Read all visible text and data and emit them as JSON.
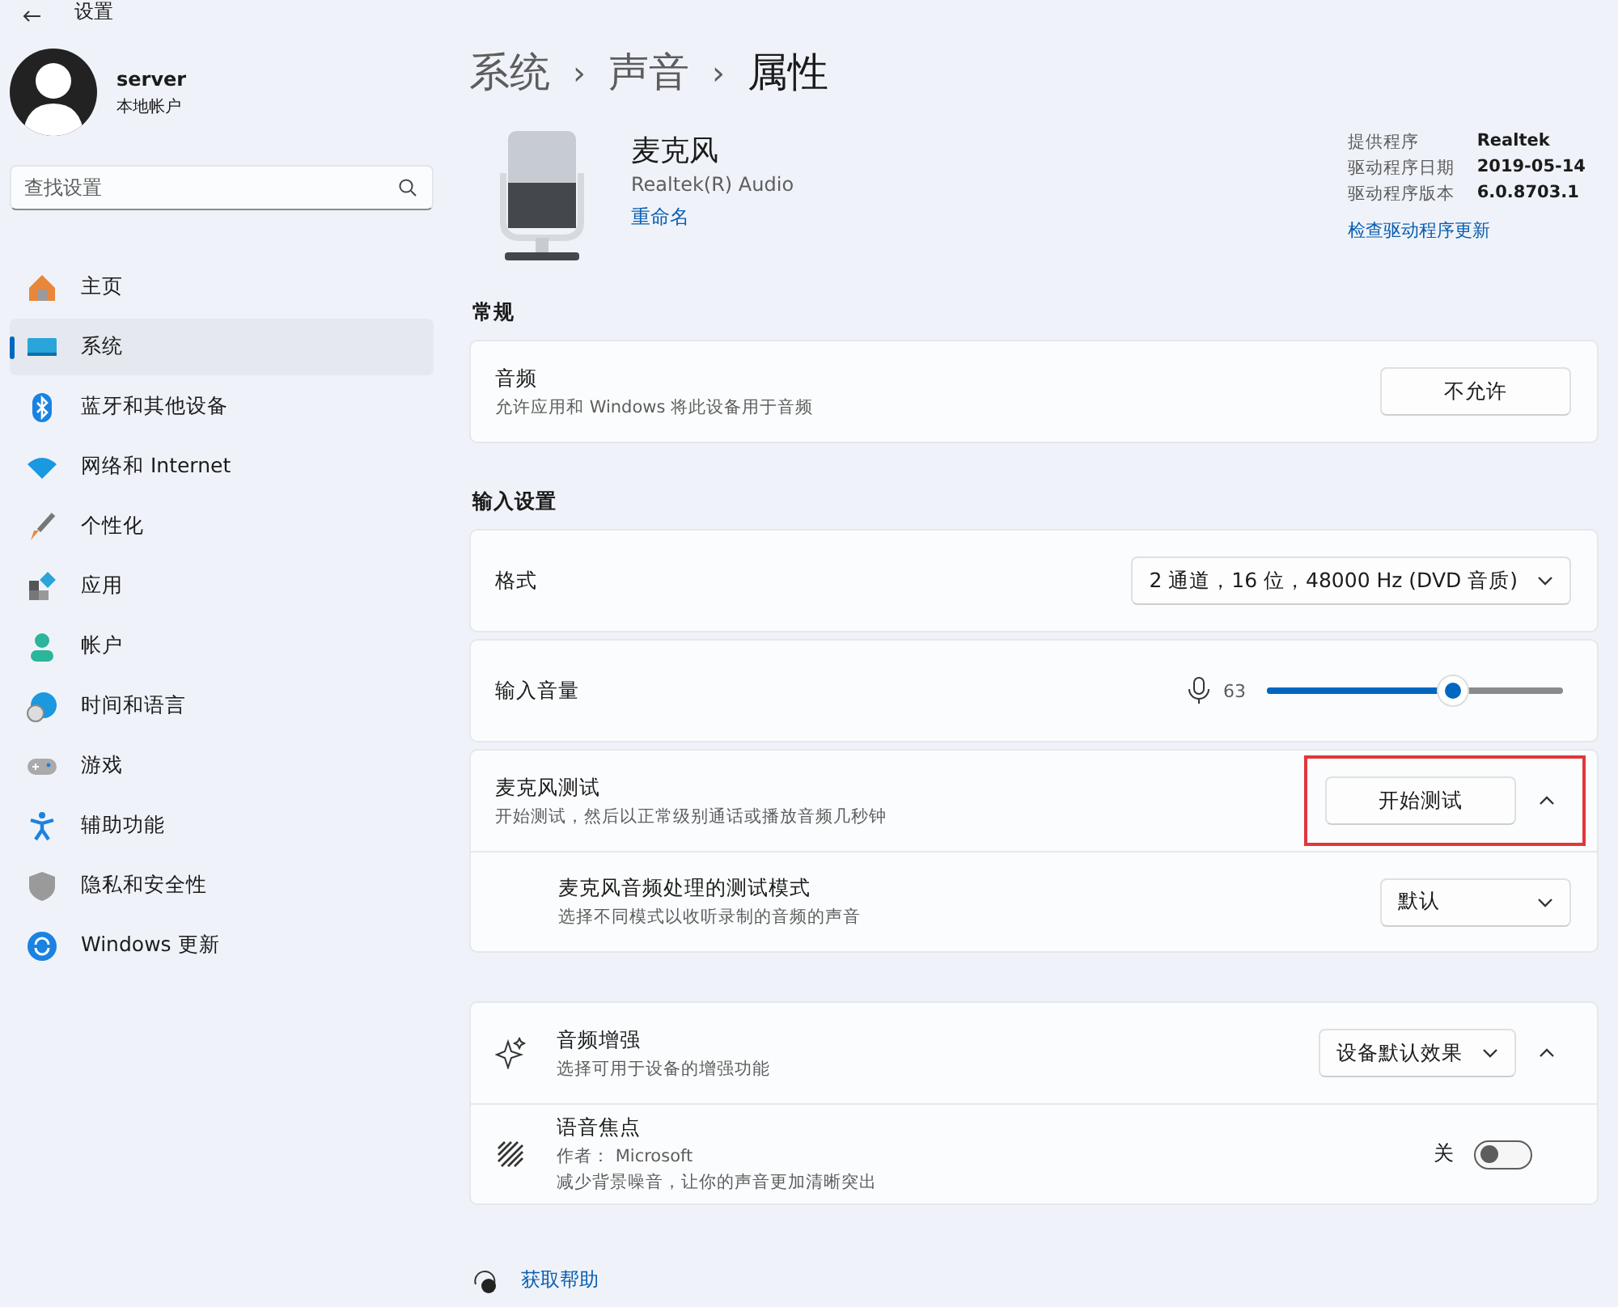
{
  "window": {
    "title": "设置"
  },
  "account": {
    "name": "server",
    "type": "本地帐户"
  },
  "search": {
    "placeholder": "查找设置"
  },
  "nav": [
    {
      "kind": "home",
      "label": "主页",
      "selected": false
    },
    {
      "kind": "system",
      "label": "系统",
      "selected": true
    },
    {
      "kind": "bluetooth",
      "label": "蓝牙和其他设备",
      "selected": false
    },
    {
      "kind": "network",
      "label": "网络和 Internet",
      "selected": false
    },
    {
      "kind": "personalize",
      "label": "个性化",
      "selected": false
    },
    {
      "kind": "apps",
      "label": "应用",
      "selected": false
    },
    {
      "kind": "accounts",
      "label": "帐户",
      "selected": false
    },
    {
      "kind": "time",
      "label": "时间和语言",
      "selected": false
    },
    {
      "kind": "gaming",
      "label": "游戏",
      "selected": false
    },
    {
      "kind": "accessibility",
      "label": "辅助功能",
      "selected": false
    },
    {
      "kind": "privacy",
      "label": "隐私和安全性",
      "selected": false
    },
    {
      "kind": "update",
      "label": "Windows 更新",
      "selected": false
    }
  ],
  "breadcrumb": [
    "系统",
    "声音",
    "属性"
  ],
  "breadcrumb_separator": "›",
  "device": {
    "name": "麦克风",
    "subtitle": "Realtek(R) Audio",
    "rename": "重命名",
    "info": [
      {
        "label": "提供程序",
        "value": "Realtek"
      },
      {
        "label": "驱动程序日期",
        "value": "2019-05-14"
      },
      {
        "label": "驱动程序版本",
        "value": "6.0.8703.1"
      }
    ],
    "update_link": "检查驱动程序更新"
  },
  "sections": [
    {
      "title": "常规",
      "groups": [
        [
          {
            "kind": "button",
            "title": "音频",
            "description": "允许应用和 Windows 将此设备用于音频",
            "button": "不允许"
          }
        ]
      ]
    },
    {
      "title": "输入设置",
      "groups": [
        [
          {
            "kind": "dropdown",
            "title": "格式",
            "value": "2 通道，16 位，48000 Hz (DVD 音质)"
          }
        ],
        [
          {
            "kind": "slider",
            "title": "输入音量",
            "reading": "63",
            "level": 0.63
          }
        ],
        [
          {
            "kind": "button",
            "title": "麦克风测试",
            "description": "开始测试，然后以正常级别通话或播放音频几秒钟",
            "button": "开始测试",
            "expanded": true,
            "highlighted": true
          },
          {
            "kind": "dropdown",
            "title": "麦克风音频处理的测试模式",
            "description": "选择不同模式以收听录制的音频的声音",
            "value": "默认",
            "sub": true
          }
        ],
        [
          {
            "kind": "dropdown",
            "title": "音频增强",
            "description": "选择可用于设备的增强功能",
            "value": "设备默认效果",
            "expanded": true
          },
          {
            "kind": "toggle",
            "title": "语音焦点",
            "author": "作者： Microsoft",
            "description": "减少背景噪音，让你的声音更加清晰突出",
            "state_label": "关",
            "on": false
          }
        ]
      ]
    }
  ],
  "help": "获取帮助"
}
